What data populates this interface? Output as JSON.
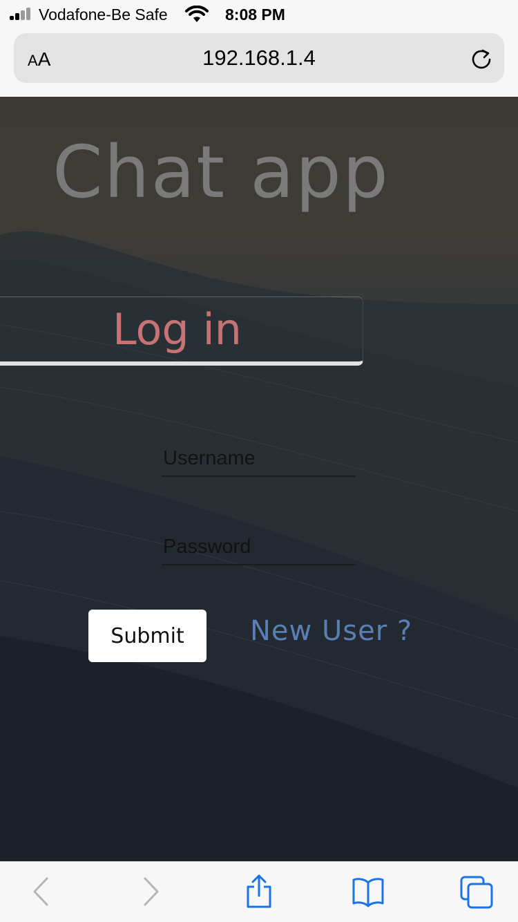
{
  "status_bar": {
    "carrier": "Vodafone-Be Safe",
    "time": "8:08 PM",
    "signal_bars_active": 2,
    "signal_bars_total": 4
  },
  "browser": {
    "text_size_label_small": "A",
    "text_size_label_large": "A",
    "url": "192.168.1.4"
  },
  "page": {
    "title": "Chat app",
    "login_heading": "Log in",
    "username_placeholder": "Username",
    "password_placeholder": "Password",
    "username_value": "",
    "password_value": "",
    "submit_label": "Submit",
    "new_user_link": "New User ?"
  },
  "toolbar": {
    "icons": [
      "back-icon",
      "forward-icon",
      "share-icon",
      "bookmarks-icon",
      "tabs-icon"
    ],
    "accent_color": "#1a73e8",
    "disabled_color": "#b5b5b5"
  },
  "colors": {
    "title": "#7a7a7a",
    "login_heading": "#c77273",
    "new_user_link": "#5a7fb5",
    "submit_bg": "#ffffff"
  }
}
